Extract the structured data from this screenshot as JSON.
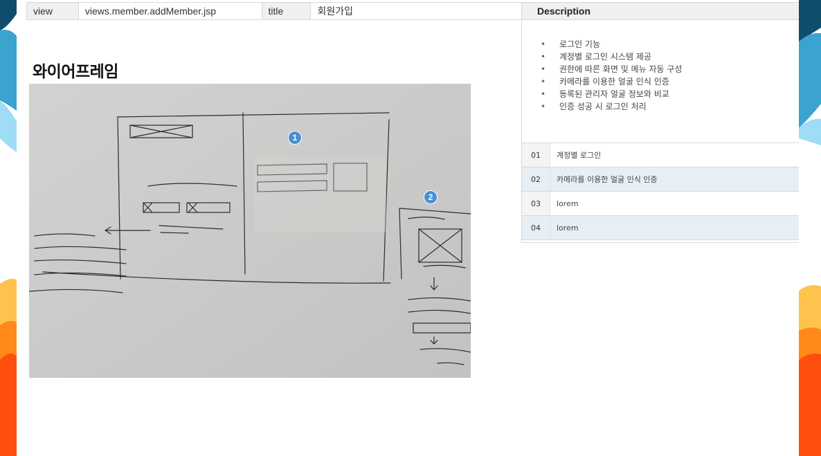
{
  "meta": {
    "view_label": "view",
    "view_value": "views.member.addMember.jsp",
    "title_label": "title",
    "title_value": "회원가입"
  },
  "description": {
    "header": "Description",
    "bullets": [
      "로그인 기능",
      "계정별 로그인 시스템 제공",
      "권한에 따른 화면 및 메뉴 자동 구성",
      "카메라를 이용한 얼굴 인식 인증",
      "등록된 관리자 얼굴 정보와 비교",
      "인증 성공 시 로그인 처리"
    ],
    "items": [
      {
        "num": "01",
        "text": "계정별 로그인"
      },
      {
        "num": "02",
        "text": "카메라를 이용한 얼굴 인식 인증"
      },
      {
        "num": "03",
        "text": "lorem"
      },
      {
        "num": "04",
        "text": "lorem"
      }
    ]
  },
  "wireframe": {
    "title": "와이어프레임",
    "badges": [
      "1",
      "2"
    ]
  },
  "colors": {
    "accent_blue": "#4a8fd4",
    "alt_row": "#e8eef6",
    "header_bg": "#f0f0f0"
  }
}
